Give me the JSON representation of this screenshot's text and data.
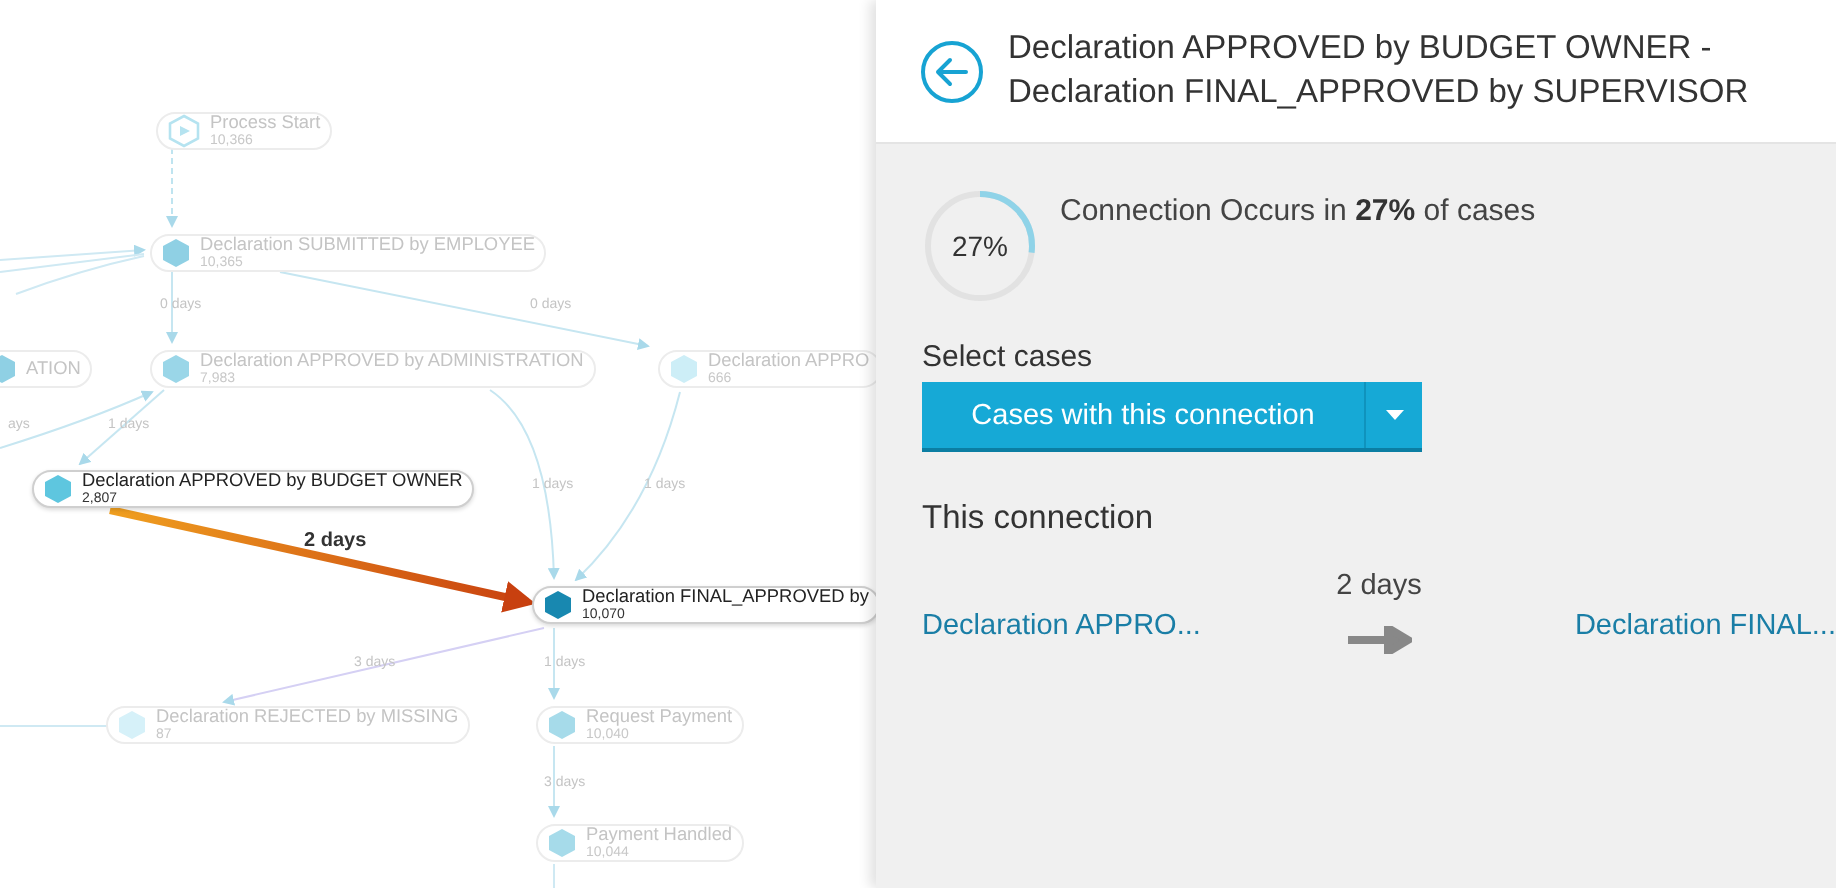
{
  "graph": {
    "nodes": [
      {
        "kind": "start",
        "label": "Process Start",
        "count": "10,366",
        "selected": false,
        "color": "#b5e3f0"
      },
      {
        "kind": "activity",
        "label": "Declaration SUBMITTED by EMPLOYEE",
        "count": "10,365",
        "selected": false,
        "color": "#8fd0e4"
      },
      {
        "kind": "activity",
        "label": "ATION",
        "selected": false,
        "color": "#8fd0e4"
      },
      {
        "kind": "activity",
        "label": "Declaration APPROVED by ADMINISTRATION",
        "count": "7,983",
        "selected": false,
        "color": "#9ad6e8"
      },
      {
        "kind": "activity",
        "label": "Declaration APPRO",
        "count": "666",
        "selected": false,
        "color": "#cdeef7"
      },
      {
        "kind": "activity",
        "label": "Declaration APPROVED by BUDGET OWNER",
        "count": "2,807",
        "selected": true,
        "color": "#5ec6df"
      },
      {
        "kind": "activity",
        "label": "Declaration FINAL_APPROVED by",
        "count": "10,070",
        "selected": true,
        "color": "#1888b0"
      },
      {
        "kind": "activity",
        "label": "Declaration REJECTED by MISSING",
        "count": "87",
        "selected": false,
        "color": "#d6f1f9"
      },
      {
        "kind": "activity",
        "label": "Request Payment",
        "count": "10,040",
        "selected": false,
        "color": "#a6dbea"
      },
      {
        "kind": "activity",
        "label": "Payment Handled",
        "count": "10,044",
        "selected": false,
        "color": "#a6dbea"
      }
    ],
    "edges": [
      {
        "label": "0 days",
        "selected": false
      },
      {
        "label": "0 days",
        "selected": false
      },
      {
        "label": "ays",
        "selected": false
      },
      {
        "label": "1 days",
        "selected": false
      },
      {
        "label": "1 days",
        "selected": false
      },
      {
        "label": "1 days",
        "selected": false
      },
      {
        "label": "2 days",
        "selected": true
      },
      {
        "label": "3 days",
        "selected": false
      },
      {
        "label": "1 days",
        "selected": false
      },
      {
        "label": "3 days",
        "selected": false
      }
    ]
  },
  "panel": {
    "title_lines": [
      "Declaration APPROVED by BUDGET OWNER -",
      "Declaration FINAL_APPROVED by SUPERVISOR"
    ],
    "occurrence": {
      "level": 0.27,
      "reading": "27%",
      "text": "Connection Occurs in **27%** of cases"
    },
    "select_label": "Select cases",
    "select_button": "Cases with this connection",
    "section_title": "This connection",
    "connection": {
      "from": "Declaration APPRO...",
      "duration": "2 days",
      "to": "Declaration FINAL..."
    }
  }
}
